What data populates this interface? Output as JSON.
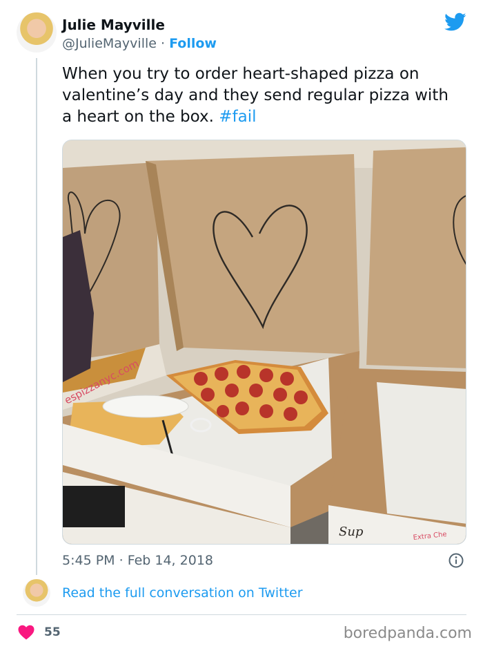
{
  "tweet": {
    "author_name": "Julie Mayville",
    "handle": "@JulieMayville",
    "separator": "·",
    "follow_label": "Follow",
    "text": "When you try to order heart-shaped pizza on valentine’s day and they send regular pizza with a heart on the box. ",
    "hashtag": "#fail",
    "time": "5:45 PM",
    "date": "Feb 14, 2018",
    "read_more": "Read the full conversation on Twitter",
    "likes": "55"
  },
  "photo": {
    "box_text_website": "espizzanyc.com",
    "box_handwriting": "Sup",
    "box_label_extra": "Extra Che"
  },
  "watermark": "boredpanda.com",
  "icons": {
    "brand": "twitter-bird-icon",
    "info": "info-icon",
    "like": "heart-icon"
  },
  "colors": {
    "link": "#1d9bf0",
    "like": "#f91880",
    "text": "#0f1419",
    "muted": "#536471"
  }
}
